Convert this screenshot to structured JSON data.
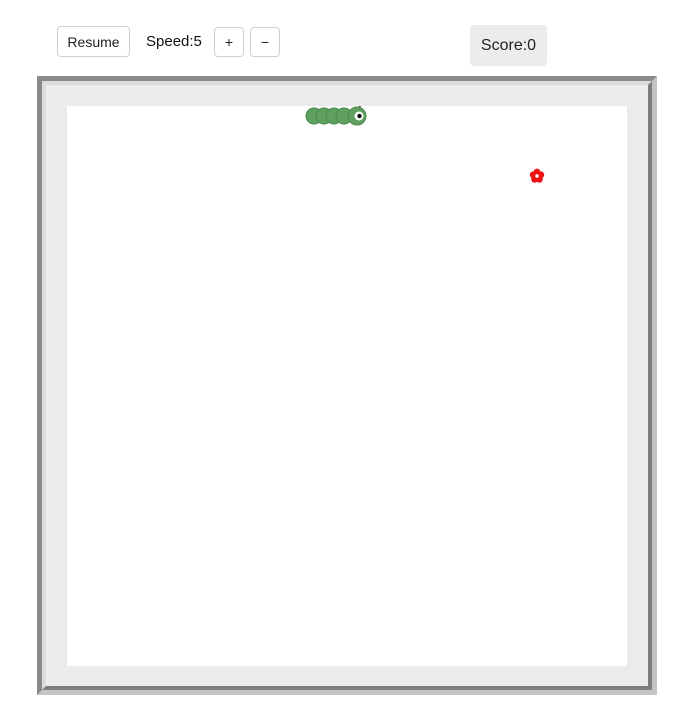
{
  "controls": {
    "resume_label": "Resume",
    "speed_label": "Speed:5",
    "speed_up_label": "+",
    "speed_down_label": "−"
  },
  "score": {
    "label": "Score:0"
  },
  "game": {
    "snake_color": "#5fa060",
    "snake_outline": "#4a8a4c",
    "food_color": "#ee1111",
    "snake_segments": 5,
    "snake_direction": "right"
  }
}
